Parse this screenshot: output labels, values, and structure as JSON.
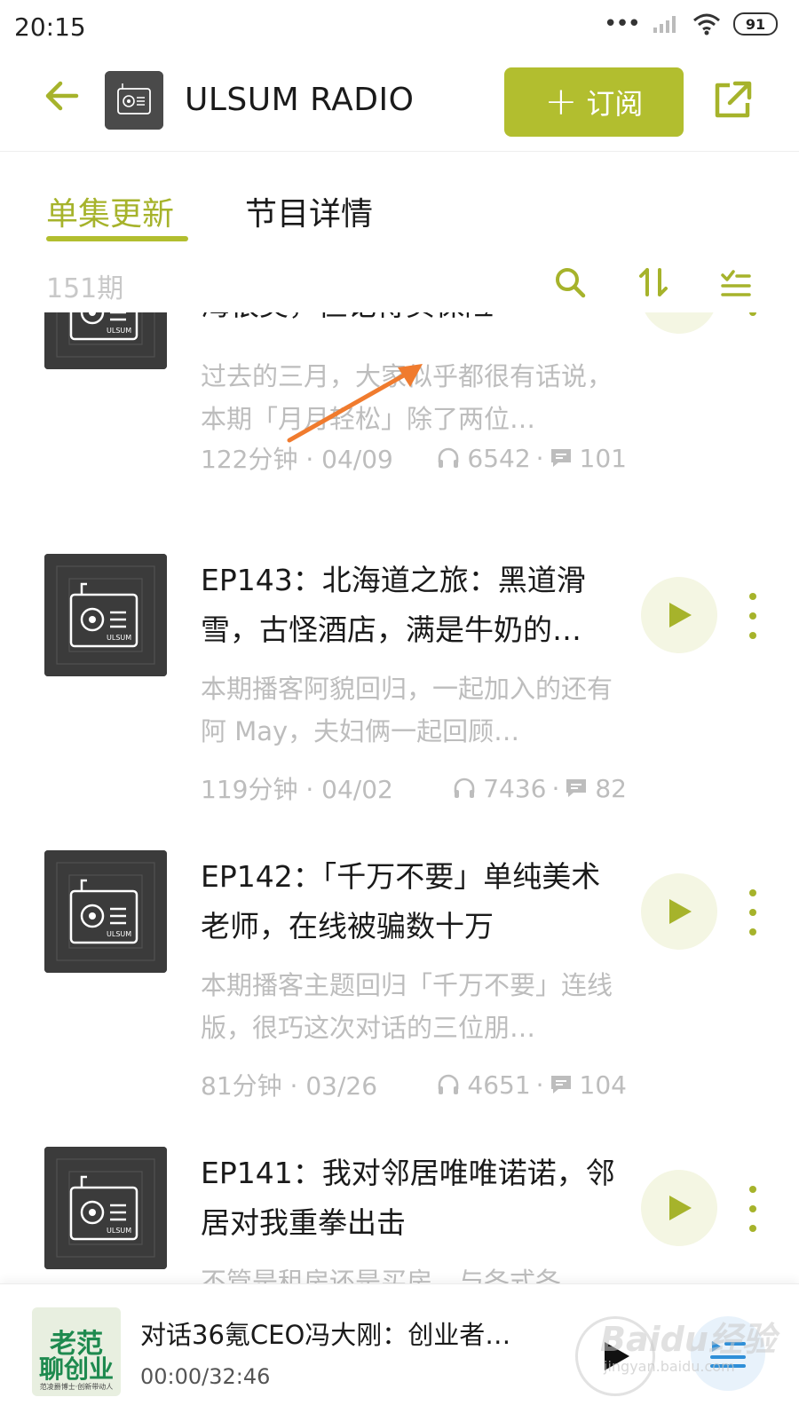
{
  "status": {
    "time": "20:15",
    "battery": "91"
  },
  "header": {
    "title": "ULSUM RADIO",
    "subscribe_label": "订阅",
    "cover_brand": "ULSUM"
  },
  "tabs": [
    {
      "label": "单集更新",
      "active": true
    },
    {
      "label": "节目详情",
      "active": false
    }
  ],
  "toolbar": {
    "episode_count": "151期"
  },
  "episodes": [
    {
      "title": "海很美，但记得买保险",
      "desc": "过去的三月，大家似乎都很有话说，本期「月月轻松」除了两位…",
      "duration_date": "122分钟 · 04/09",
      "plays": "6542",
      "comments": "101"
    },
    {
      "title": "EP143：北海道之旅：黑道滑雪，古怪酒店，满是牛奶的…",
      "desc": "本期播客阿貌回归，一起加入的还有阿 May，夫妇俩一起回顾…",
      "duration_date": "119分钟 · 04/02",
      "plays": "7436",
      "comments": "82"
    },
    {
      "title": "EP142：「千万不要」单纯美术老师，在线被骗数十万",
      "desc": "本期播客主题回归「千万不要」连线版，很巧这次对话的三位朋…",
      "duration_date": "81分钟 · 03/26",
      "plays": "4651",
      "comments": "104"
    },
    {
      "title": "EP141：我对邻居唯唯诺诺，邻居对我重拳出击",
      "desc": "不管是租房还是买房，与各式各…",
      "duration_date": "",
      "plays": "",
      "comments": ""
    }
  ],
  "player": {
    "title": "对话36氪CEO冯大刚：创业者…",
    "time": "00:00/32:46",
    "cover_line1": "老范",
    "cover_line2": "聊创业",
    "cover_line3": "范凌爵博士·创新带动人"
  },
  "watermark": {
    "main": "Baidu经验",
    "sub": "jingyan.baidu.com"
  },
  "colors": {
    "accent": "#b2be2f",
    "accent_text": "#a6b32b",
    "muted": "#bdbdbd",
    "annotation": "#f07b2e"
  },
  "icons": {
    "back": "arrow-left-icon",
    "share": "share-external-icon",
    "search": "search-icon",
    "sort": "sort-icon",
    "filter": "list-filter-icon",
    "play": "play-icon",
    "more": "more-vertical-icon",
    "headphone": "headphone-icon",
    "comment": "comment-icon",
    "playlist": "playlist-icon"
  }
}
